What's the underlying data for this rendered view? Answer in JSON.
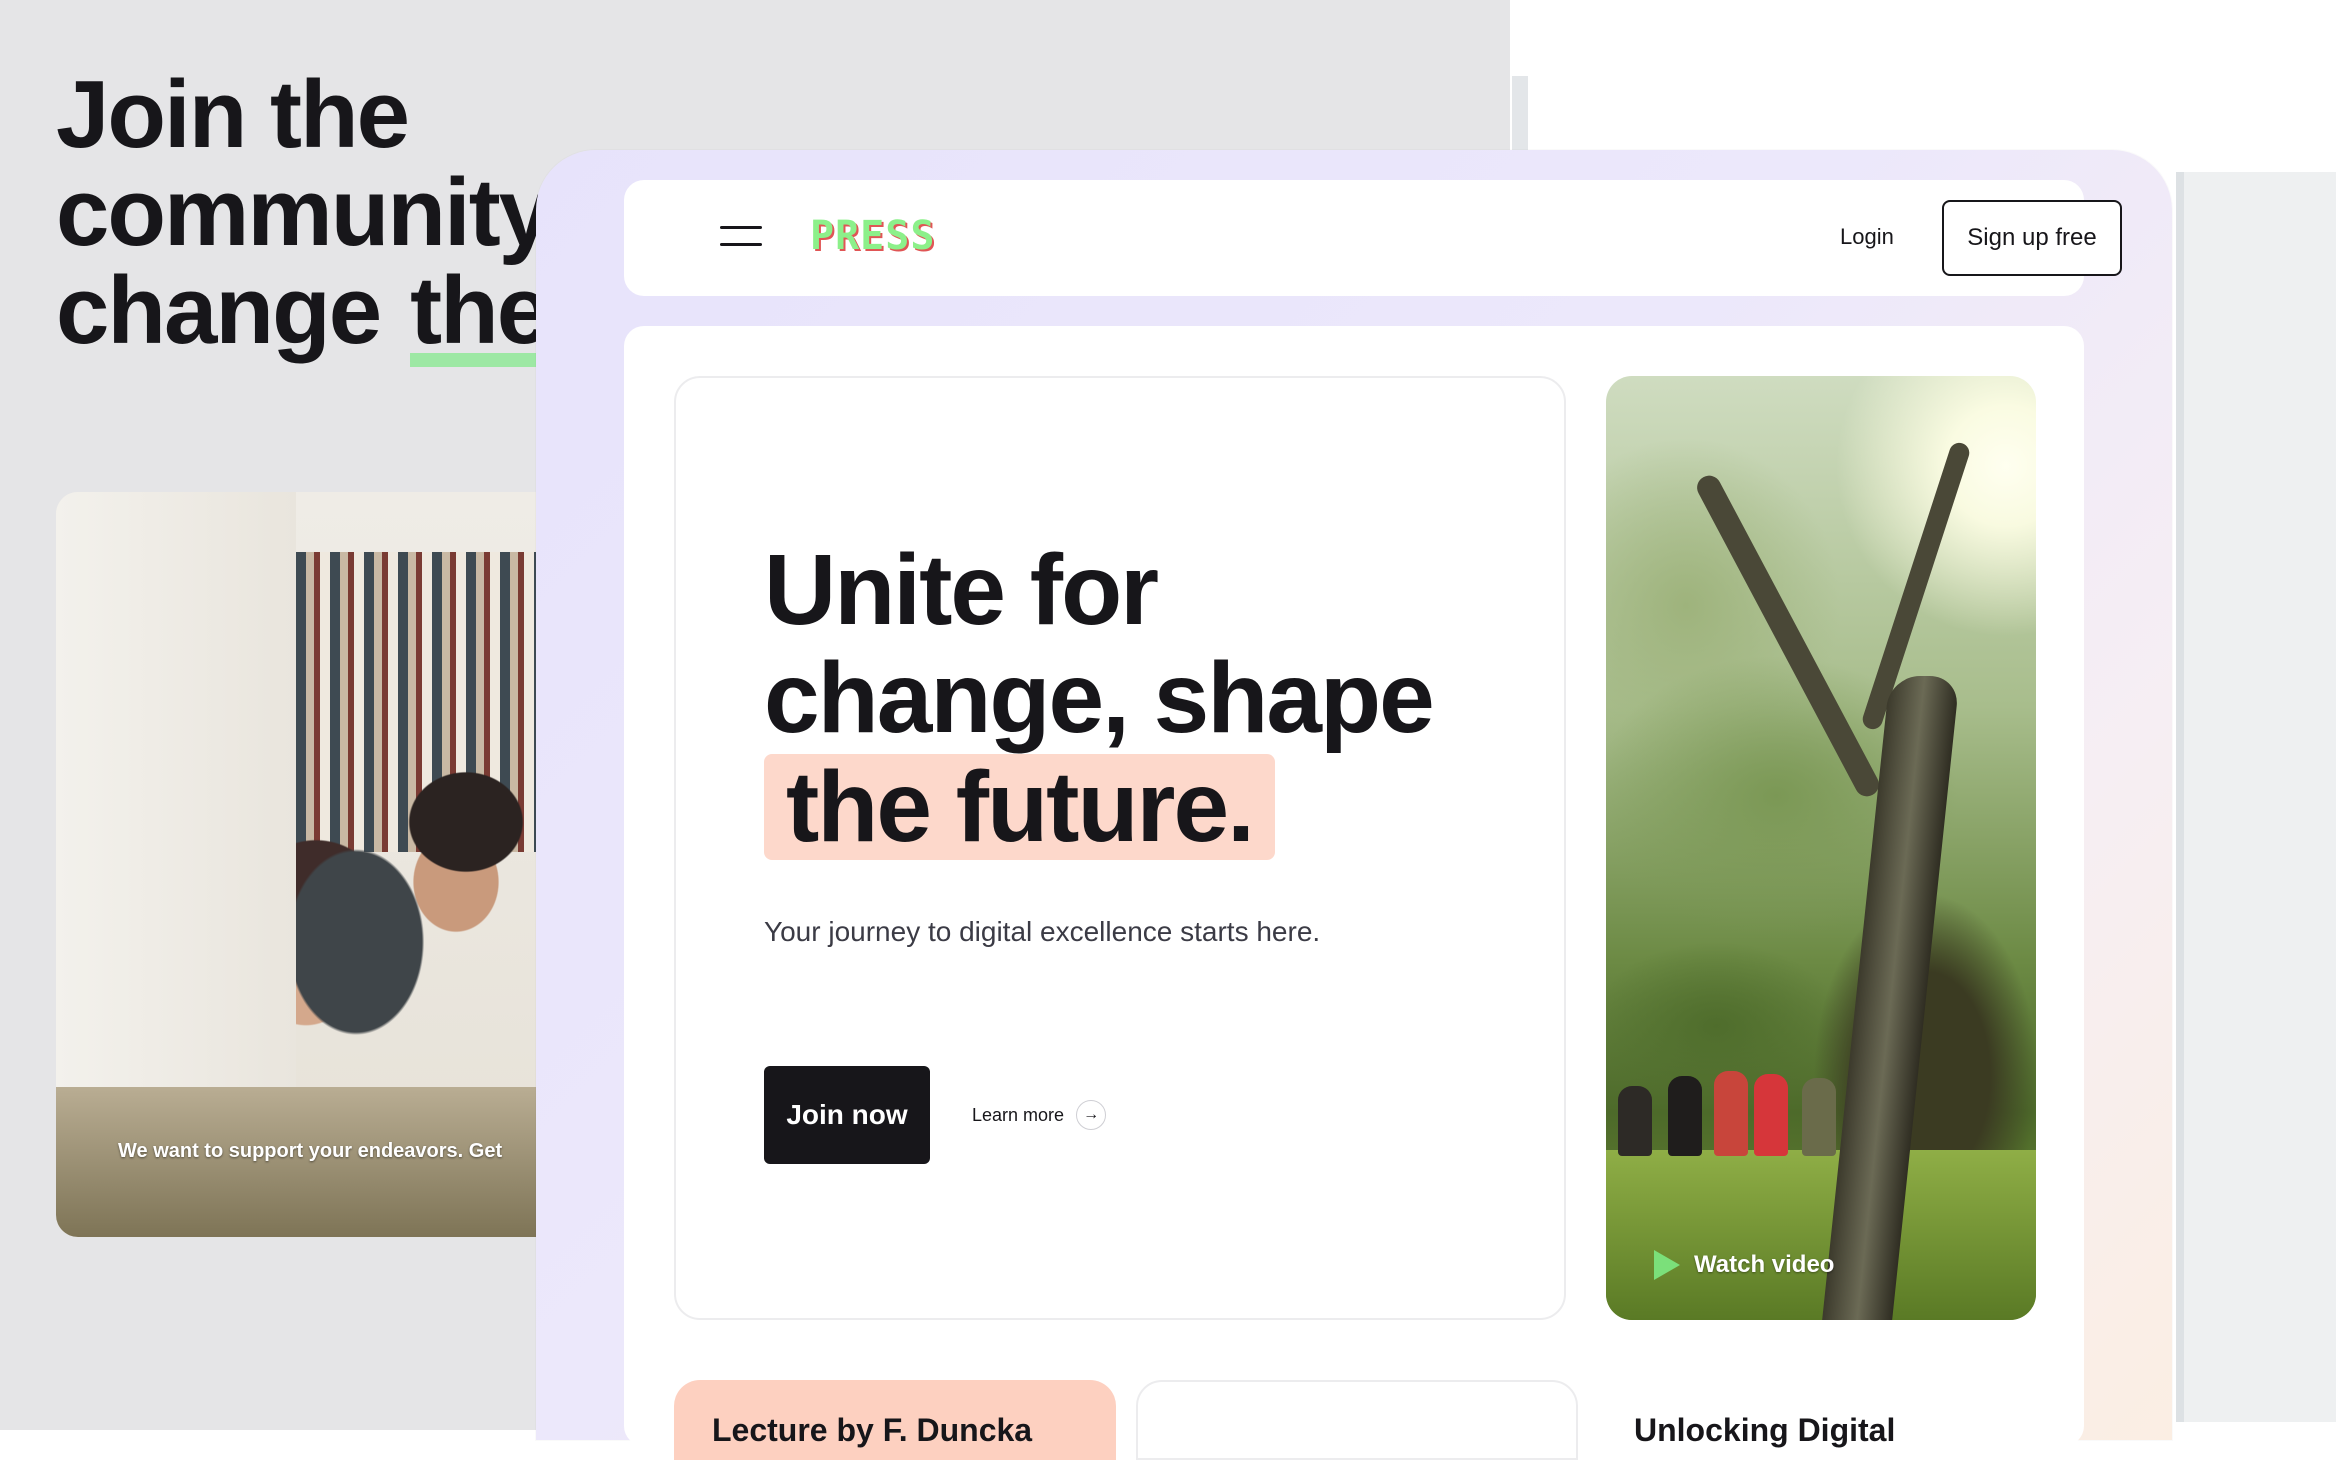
{
  "back_page": {
    "heading_lines": [
      "Join the",
      "community",
      "change"
    ],
    "heading_highlight": "the",
    "photo_caption": "We want to support your endeavors. Get"
  },
  "nav": {
    "logo": "PRESS",
    "login": "Login",
    "signup": "Sign up free",
    "menu_icon": "hamburger-menu-icon"
  },
  "hero": {
    "title_line1": "Unite for",
    "title_line2": "change, shape",
    "title_highlight": "the future.",
    "subtitle": "Your journey to digital excellence starts here.",
    "primary_button": "Join now",
    "secondary_link": "Learn more",
    "arrow_icon": "→",
    "highlight_color": "#fdd8cb"
  },
  "video": {
    "label": "Watch video",
    "play_icon": "play-icon",
    "play_color": "#7be07a"
  },
  "bottom_cards": {
    "card1_title": "Lecture by F. Duncka",
    "card3_title": "Unlocking Digital"
  },
  "colors": {
    "accent_green": "#8cf08a",
    "dark": "#17161a",
    "peach": "#fdd0c0"
  }
}
